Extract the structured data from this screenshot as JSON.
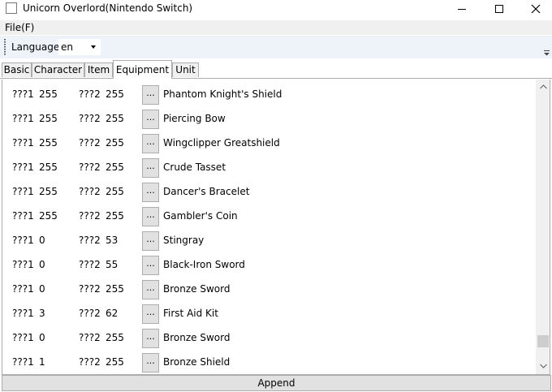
{
  "window": {
    "title": "Unicorn Overlord(Nintendo Switch)"
  },
  "menu": {
    "file": "File(F)"
  },
  "toolbar": {
    "language_label": "Language",
    "language_value": "en"
  },
  "tabs": [
    "Basic",
    "Character",
    "Item",
    "Equipment",
    "Unit"
  ],
  "active_tab": "Equipment",
  "equipment": {
    "button_label": "...",
    "rows": [
      {
        "k1": "???1",
        "v1": "255",
        "k2": "???2",
        "v2": "255",
        "name": "Phantom Knight's Shield"
      },
      {
        "k1": "???1",
        "v1": "255",
        "k2": "???2",
        "v2": "255",
        "name": "Piercing Bow"
      },
      {
        "k1": "???1",
        "v1": "255",
        "k2": "???2",
        "v2": "255",
        "name": "Wingclipper Greatshield"
      },
      {
        "k1": "???1",
        "v1": "255",
        "k2": "???2",
        "v2": "255",
        "name": "Crude Tasset"
      },
      {
        "k1": "???1",
        "v1": "255",
        "k2": "???2",
        "v2": "255",
        "name": "Dancer's Bracelet"
      },
      {
        "k1": "???1",
        "v1": "255",
        "k2": "???2",
        "v2": "255",
        "name": "Gambler's Coin"
      },
      {
        "k1": "???1",
        "v1": "0",
        "k2": "???2",
        "v2": "53",
        "name": "Stingray"
      },
      {
        "k1": "???1",
        "v1": "0",
        "k2": "???2",
        "v2": "55",
        "name": "Black-Iron Sword"
      },
      {
        "k1": "???1",
        "v1": "0",
        "k2": "???2",
        "v2": "255",
        "name": "Bronze Sword"
      },
      {
        "k1": "???1",
        "v1": "3",
        "k2": "???2",
        "v2": "62",
        "name": "First Aid Kit"
      },
      {
        "k1": "???1",
        "v1": "0",
        "k2": "???2",
        "v2": "255",
        "name": "Bronze Sword"
      },
      {
        "k1": "???1",
        "v1": "1",
        "k2": "???2",
        "v2": "255",
        "name": "Bronze Shield"
      }
    ],
    "scroll_position": 0.95
  },
  "append_label": "Append"
}
